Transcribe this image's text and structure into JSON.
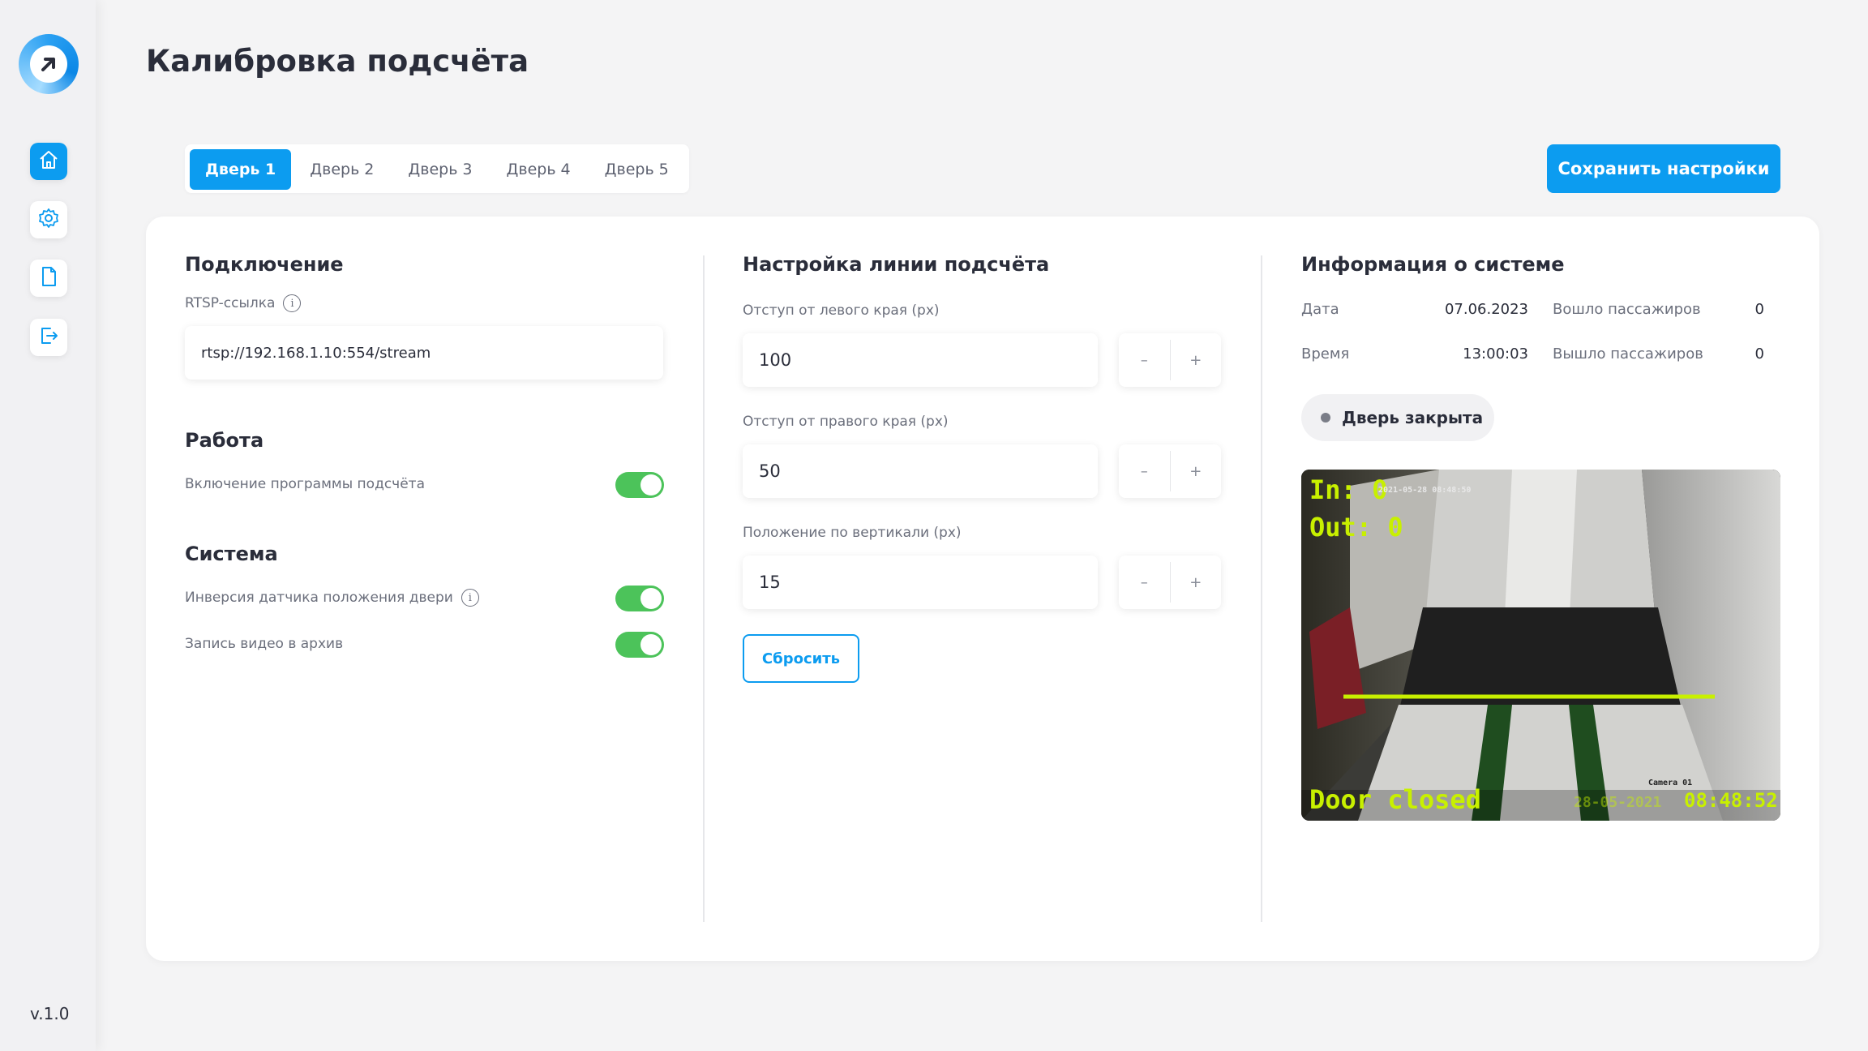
{
  "app": {
    "version": "v.1.0",
    "title": "Калибровка подсчёта"
  },
  "sidebar": {
    "items": [
      {
        "name": "home",
        "icon": "home-icon",
        "active": true
      },
      {
        "name": "settings",
        "icon": "gear-icon",
        "active": false
      },
      {
        "name": "documents",
        "icon": "document-icon",
        "active": false
      },
      {
        "name": "logout",
        "icon": "logout-icon",
        "active": false
      }
    ]
  },
  "tabs": [
    {
      "label": "Дверь 1",
      "active": true
    },
    {
      "label": "Дверь 2",
      "active": false
    },
    {
      "label": "Дверь 3",
      "active": false
    },
    {
      "label": "Дверь 4",
      "active": false
    },
    {
      "label": "Дверь 5",
      "active": false
    }
  ],
  "toolbar": {
    "save_label": "Сохранить настройки"
  },
  "connection": {
    "title": "Подключение",
    "rtsp_label": "RTSP-ссылка",
    "rtsp_value": "rtsp://192.168.1.10:554/stream"
  },
  "work": {
    "title": "Работа",
    "enable_label": "Включение программы подсчёта",
    "enable_on": true
  },
  "system": {
    "title": "Система",
    "inversion_label": "Инверсия датчика положения двери",
    "inversion_on": true,
    "record_label": "Запись видео в архив",
    "record_on": true
  },
  "line": {
    "title": "Настройка линии подсчёта",
    "left_label": "Отступ от левого края (px)",
    "left_value": "100",
    "right_label": "Отступ от правого края (px)",
    "right_value": "50",
    "vertical_label": "Положение по вертикали (px)",
    "vertical_value": "15",
    "minus": "–",
    "plus": "+",
    "reset_label": "Сбросить"
  },
  "info": {
    "title": "Информация о системе",
    "date_label": "Дата",
    "date_value": "07.06.2023",
    "time_label": "Время",
    "time_value": "13:00:03",
    "in_label": "Вошло пассажиров",
    "in_value": "0",
    "out_label": "Вышло пассажиров",
    "out_value": "0",
    "door_status": "Дверь закрыта"
  },
  "camera": {
    "in_text": "In: 0",
    "out_text": "Out: 0",
    "door_text": "Door closed",
    "time_text": "08:48:52",
    "top_stamp": "2021-05-28 08:48:50",
    "cam_id": "Camera 01",
    "bottom_date": "28-05-2021"
  },
  "colors": {
    "accent": "#0c9cf0",
    "toggle_on": "#4cc35a",
    "overlay_text": "#c8f000"
  }
}
